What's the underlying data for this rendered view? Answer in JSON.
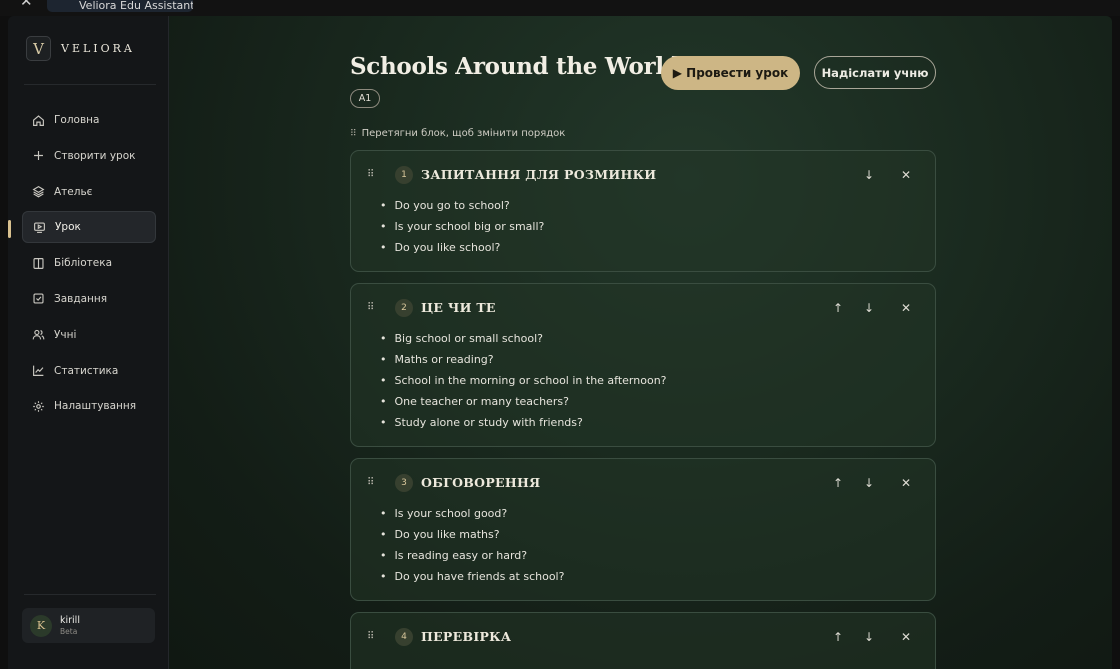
{
  "app": {
    "tab_title": "Veliora Edu Assistant",
    "brand_initial": "V",
    "brand_name": "VELIORA"
  },
  "sidebar": {
    "items": [
      {
        "label": "Головна",
        "icon": "home-icon"
      },
      {
        "label": "Створити урок",
        "icon": "plus-icon"
      },
      {
        "label": "Ательє",
        "icon": "layers-icon"
      },
      {
        "label": "Урок",
        "icon": "presentation-icon",
        "active": true
      },
      {
        "label": "Бібліотека",
        "icon": "book-icon"
      },
      {
        "label": "Завдання",
        "icon": "checkbox-icon"
      },
      {
        "label": "Учні",
        "icon": "users-icon"
      },
      {
        "label": "Статистика",
        "icon": "chart-line-icon"
      },
      {
        "label": "Налаштування",
        "icon": "gear-icon"
      }
    ],
    "user": {
      "initial": "K",
      "name": "kirill",
      "tag": "Beta"
    }
  },
  "lesson": {
    "title": "Schools Around the World",
    "level": "A1",
    "start_button": "▶ Провести урок",
    "send_button": "Надіслати учню",
    "reorder_hint": "Перетягни блок, щоб змінити порядок"
  },
  "blocks": [
    {
      "num": "1",
      "title": "ЗАПИТАННЯ ДЛЯ РОЗМИНКИ",
      "items": [
        "Do you go to school?",
        "Is your school big or small?",
        "Do you like school?"
      ]
    },
    {
      "num": "2",
      "title": "ЦЕ ЧИ ТЕ",
      "items": [
        "Big school or small school?",
        "Maths or reading?",
        "School in the morning or school in the afternoon?",
        "One teacher or many teachers?",
        "Study alone or study with friends?"
      ]
    },
    {
      "num": "3",
      "title": "ОБГОВОРЕННЯ",
      "items": [
        "Is your school good?",
        "Do you like maths?",
        "Is reading easy or hard?",
        "Do you have friends at school?"
      ]
    },
    {
      "num": "4",
      "title": "ПЕРЕВІРКА",
      "items": []
    }
  ],
  "colors": {
    "accent": "#cdb685",
    "background": "#15171a",
    "main_green": "#1a2a1f"
  }
}
